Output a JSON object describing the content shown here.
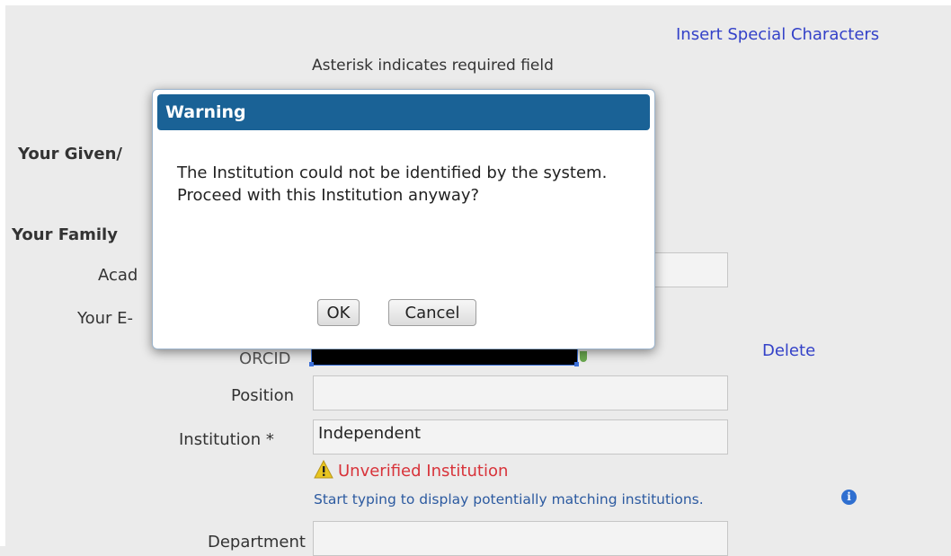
{
  "header": {
    "special_chars_link": "Insert Special Characters",
    "required_note": "Asterisk indicates required field"
  },
  "form": {
    "given_name_label": "Your Given/",
    "family_name_label": "Your Family",
    "academic_label": "Acad",
    "email_label": "Your E-",
    "orcid_label": "ORCID",
    "orcid_delete_link": "Delete",
    "position_label": "Position",
    "position_value": "",
    "institution_label": "Institution *",
    "institution_value": "Independent",
    "unverified_text": "Unverified Institution",
    "hint_text": "Start typing to display potentially matching institutions.",
    "department_label": "Department"
  },
  "dialog": {
    "title": "Warning",
    "message": "The Institution could not be identified by the system. Proceed with this Institution anyway?",
    "ok_label": "OK",
    "cancel_label": "Cancel"
  },
  "colors": {
    "dialog_title_bg": "#1a6296",
    "link": "#3341c8",
    "warning_text": "#d8333a",
    "hint_text": "#2c5aa0"
  },
  "icons": {
    "warning": "warning-triangle-icon",
    "info": "info-circle-icon"
  }
}
